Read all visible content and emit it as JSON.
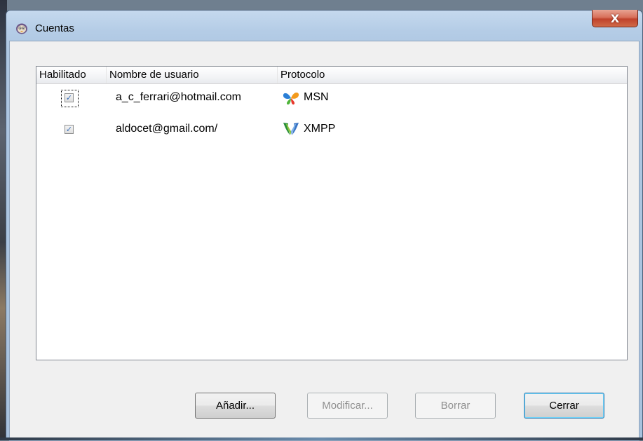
{
  "window": {
    "title": "Cuentas",
    "close_glyph": "X"
  },
  "accounts_list": {
    "columns": [
      "Habilitado",
      "Nombre de usuario",
      "Protocolo"
    ],
    "rows": [
      {
        "enabled": true,
        "enabled_glyph": "✓",
        "username": "a_c_ferrari@hotmail.com",
        "protocol": "MSN",
        "protocol_icon": "msn-butterfly-icon"
      },
      {
        "enabled": true,
        "enabled_glyph": "✓",
        "username": "aldocet@gmail.com/",
        "protocol": "XMPP",
        "protocol_icon": "xmpp-icon"
      }
    ]
  },
  "buttons": {
    "add": "Añadir...",
    "modify": "Modificar...",
    "delete": "Borrar",
    "close": "Cerrar"
  },
  "colors": {
    "title_bar": "#b4cce6",
    "close_button": "#c0432c",
    "checkbox_mark": "#3a6fb8",
    "disabled_text": "#8f8f8f"
  }
}
